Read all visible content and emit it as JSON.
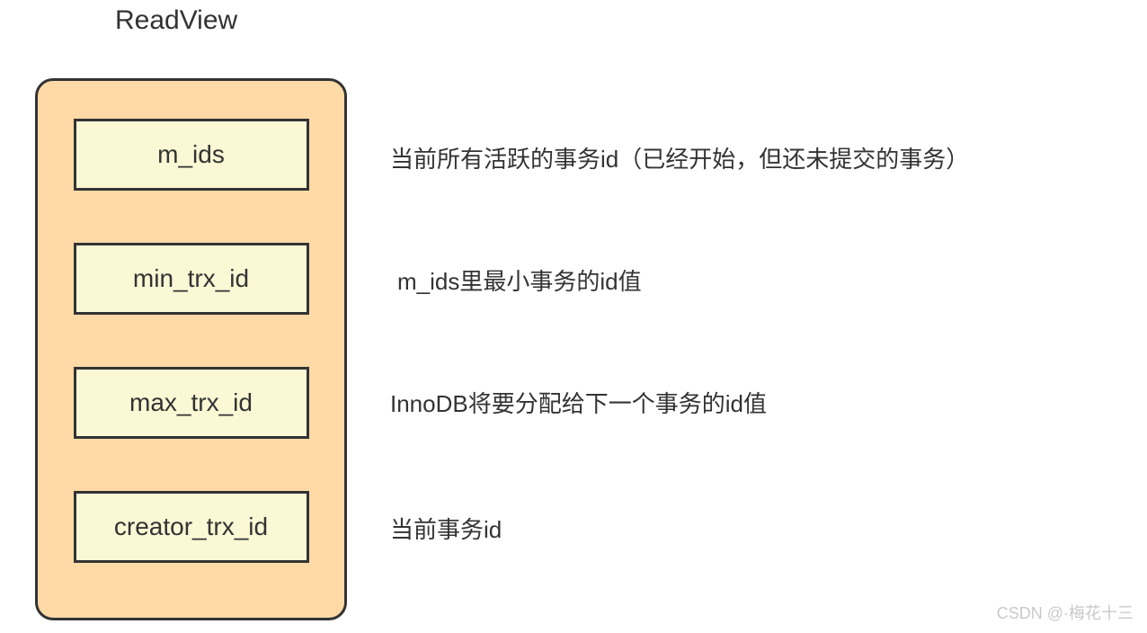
{
  "title": "ReadView",
  "fields": [
    {
      "name": "m_ids",
      "desc": "当前所有活跃的事务id（已经开始，但还未提交的事务）"
    },
    {
      "name": "min_trx_id",
      "desc": "m_ids里最小事务的id值"
    },
    {
      "name": "max_trx_id",
      "desc": "InnoDB将要分配给下一个事务的id值"
    },
    {
      "name": "creator_trx_id",
      "desc": "当前事务id"
    }
  ],
  "watermark": "CSDN @·梅花十三",
  "colors": {
    "container_bg": "#FFD9A6",
    "field_bg": "#FAF8D5",
    "border": "#333333",
    "text": "#333333"
  }
}
